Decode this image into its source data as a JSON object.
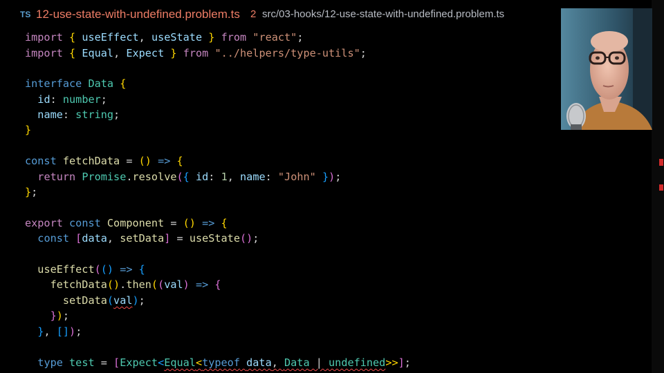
{
  "tab": {
    "icon": "TS",
    "filename": "12-use-state-with-undefined.problem.ts",
    "problem_count": "2",
    "path": "src/03-hooks/12-use-state-with-undefined.problem.ts"
  },
  "code": {
    "l1": {
      "t0": "import",
      "t1": " ",
      "t2": "{",
      "t3": " ",
      "t4": "useEffect",
      "t5": ", ",
      "t6": "useState",
      "t7": " ",
      "t8": "}",
      "t9": " ",
      "t10": "from",
      "t11": " ",
      "t12": "\"react\"",
      "t13": ";"
    },
    "l2": {
      "t0": "import",
      "t1": " ",
      "t2": "{",
      "t3": " ",
      "t4": "Equal",
      "t5": ", ",
      "t6": "Expect",
      "t7": " ",
      "t8": "}",
      "t9": " ",
      "t10": "from",
      "t11": " ",
      "t12": "\"../helpers/type-utils\"",
      "t13": ";"
    },
    "l4": {
      "t0": "interface",
      "t1": " ",
      "t2": "Data",
      "t3": " ",
      "t4": "{"
    },
    "l5": {
      "t0": "  ",
      "t1": "id",
      "t2": ": ",
      "t3": "number",
      "t4": ";"
    },
    "l6": {
      "t0": "  ",
      "t1": "name",
      "t2": ": ",
      "t3": "string",
      "t4": ";"
    },
    "l7": {
      "t0": "}"
    },
    "l9": {
      "t0": "const",
      "t1": " ",
      "t2": "fetchData",
      "t3": " = ",
      "t4": "()",
      "t5": " ",
      "t6": "=>",
      "t7": " ",
      "t8": "{"
    },
    "l10": {
      "t0": "  ",
      "t1": "return",
      "t2": " ",
      "t3": "Promise",
      "t4": ".",
      "t5": "resolve",
      "t6": "(",
      "t7": "{",
      "t8": " ",
      "t9": "id",
      "t10": ": ",
      "t11": "1",
      "t12": ", ",
      "t13": "name",
      "t14": ": ",
      "t15": "\"John\"",
      "t16": " ",
      "t17": "}",
      "t18": ")",
      "t19": ";"
    },
    "l11": {
      "t0": "}",
      "t1": ";"
    },
    "l13": {
      "t0": "export",
      "t1": " ",
      "t2": "const",
      "t3": " ",
      "t4": "Component",
      "t5": " = ",
      "t6": "()",
      "t7": " ",
      "t8": "=>",
      "t9": " ",
      "t10": "{"
    },
    "l14": {
      "t0": "  ",
      "t1": "const",
      "t2": " ",
      "t3": "[",
      "t4": "data",
      "t5": ", ",
      "t6": "setData",
      "t7": "]",
      "t8": " = ",
      "t9": "useState",
      "t10": "()",
      "t11": ";"
    },
    "l16": {
      "t0": "  ",
      "t1": "useEffect",
      "t2": "(",
      "t3": "()",
      "t4": " ",
      "t5": "=>",
      "t6": " ",
      "t7": "{"
    },
    "l17": {
      "t0": "    ",
      "t1": "fetchData",
      "t2": "()",
      "t3": ".",
      "t4": "then",
      "t5": "(",
      "t6": "(",
      "t7": "val",
      "t8": ")",
      "t9": " ",
      "t10": "=>",
      "t11": " ",
      "t12": "{"
    },
    "l18": {
      "t0": "      ",
      "t1": "setData",
      "t2": "(",
      "t3": "val",
      "t4": ")",
      "t5": ";"
    },
    "l19": {
      "t0": "    ",
      "t1": "}",
      "t2": ")",
      "t3": ";"
    },
    "l20": {
      "t0": "  ",
      "t1": "}",
      "t2": ", ",
      "t3": "[]",
      "t4": ")",
      "t5": ";"
    },
    "l22": {
      "t0": "  ",
      "t1": "type",
      "t2": " ",
      "t3": "test",
      "t4": " = ",
      "t5": "[",
      "t6": "Expect",
      "t7": "<",
      "t8": "Equal",
      "t9": "<",
      "t10": "typeof",
      "t11": " ",
      "t12": "data",
      "t13": ", ",
      "t14": "Data",
      "t15": " | ",
      "t16": "undefined",
      "t17": ">>",
      "t18": "]",
      "t19": ";"
    }
  },
  "colors": {
    "background": "#000000",
    "tab_filename": "#ee7d66",
    "error_marker": "#d12b2b"
  },
  "webcam": {
    "description_icon": "presenter-video-icon"
  }
}
